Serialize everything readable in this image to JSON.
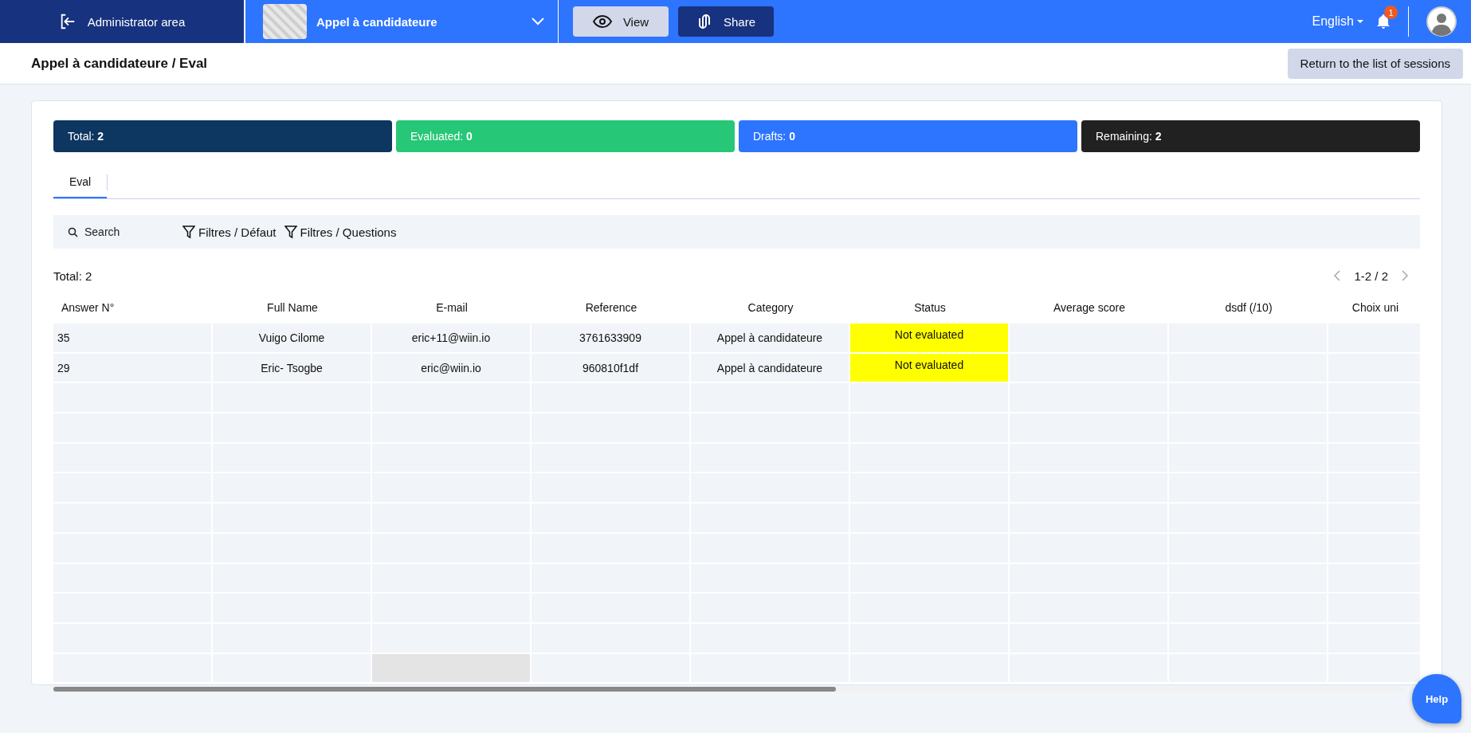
{
  "topbar": {
    "admin_link": "Administrator area",
    "form_title": "Appel à candidateure",
    "view_button": "View",
    "share_button": "Share",
    "language": "English",
    "notification_count": "1"
  },
  "header": {
    "breadcrumb": "Appel à candidateure / Eval",
    "return_button": "Return to the list of sessions"
  },
  "stats": [
    {
      "label": "Total:",
      "value": "2",
      "color": "#0d3660"
    },
    {
      "label": "Evaluated:",
      "value": "0",
      "color": "#26c776"
    },
    {
      "label": "Drafts:",
      "value": "0",
      "color": "#2d74ff"
    },
    {
      "label": "Remaining:",
      "value": "2",
      "color": "#212121"
    }
  ],
  "tabs": [
    {
      "label": "Eval",
      "selected": true
    }
  ],
  "toolbar": {
    "search_placeholder": "Search",
    "filters": [
      "Filtres / Défaut",
      "Filtres / Questions"
    ]
  },
  "table": {
    "total": "Total: 2",
    "pagination": "1-2 / 2",
    "columns": [
      "Answer N°",
      "Full Name",
      "E-mail",
      "Reference",
      "Category",
      "Status",
      "Average score",
      "dsdf (/10)",
      "Choix uni"
    ],
    "rows": [
      {
        "answer": "35",
        "full_name": "Vuigo Cilome",
        "email": "eric+11@wiin.io",
        "reference": "3761633909",
        "category": "Appel à candidateure",
        "status": "Not evaluated",
        "color": "#ffff00"
      },
      {
        "answer": "29",
        "full_name": "Eric- Tsogbe",
        "email": "eric@wiin.io",
        "reference": "960810f1df",
        "category": "Appel à candidateure",
        "status": "Not evaluated",
        "color": "#ffff00"
      }
    ]
  },
  "help_button": "Help"
}
